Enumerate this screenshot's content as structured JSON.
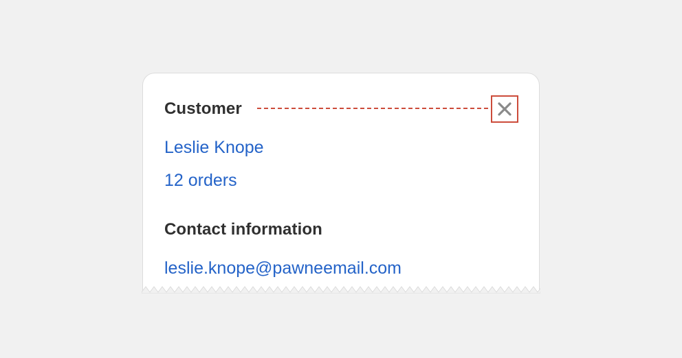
{
  "card": {
    "customer_heading": "Customer",
    "customer_name": "Leslie Knope",
    "orders_link": "12 orders",
    "contact_heading": "Contact information",
    "email": "leslie.knope@pawneemail.com"
  },
  "icons": {
    "close": "close-icon"
  },
  "colors": {
    "background": "#f1f1f1",
    "card": "#ffffff",
    "link": "#2463c8",
    "heading": "#303030",
    "highlight": "#cc4b3a",
    "icon": "#8a8a8a"
  }
}
